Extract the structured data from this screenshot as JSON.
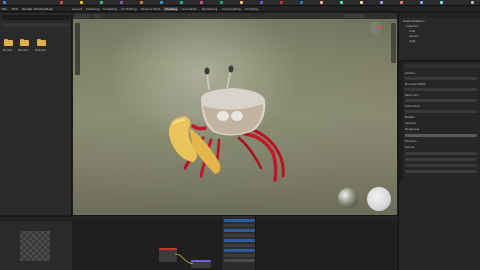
{
  "app": {
    "title": "Blender",
    "colors": {
      "accent": "#4772b3",
      "header": "#232323",
      "panel": "#2a2a2a",
      "folder": "#e2b04b",
      "crab_red": "#c0182a",
      "crab_claw": "#e8c45a"
    }
  },
  "menu": [
    "File",
    "Edit",
    "Render",
    "Window",
    "Help"
  ],
  "workspaces": {
    "items": [
      "Layout",
      "Modeling",
      "Sculpting",
      "UV Editing",
      "Texture Paint",
      "Shading",
      "Animation",
      "Rendering",
      "Compositing",
      "Scripting"
    ],
    "active": "Shading"
  },
  "file_browser": {
    "folders": [
      {
        "label": "Models"
      },
      {
        "label": "Renders"
      },
      {
        "label": "Textures"
      }
    ]
  },
  "viewport": {
    "mode_label": "Object Mode",
    "shading": "Material Preview",
    "subject": "fiddler-crab-model",
    "icons": {
      "gizmo": "navigation-gizmo-icon",
      "hdri": "hdri-preview-sphere-icon"
    }
  },
  "outliner": {
    "header": "Scene Collection",
    "items": [
      "Collection",
      "Crab",
      "Camera",
      "Light"
    ]
  },
  "properties": {
    "panels": [
      "Surface",
      "Principled BSDF",
      "Base Color",
      "Subsurface",
      "Metallic",
      "Specular",
      "Roughness",
      "Emission",
      "Normal"
    ]
  },
  "shader_list": {
    "items": [
      "Principled",
      "Image Texture",
      "Mix Shader",
      "Bump",
      "Mapping",
      "Coordinate",
      "ColorRamp",
      "Noise",
      "Output"
    ]
  },
  "bottom": {
    "image_editor": "Image Editor",
    "node_editor": "Shader Editor"
  }
}
